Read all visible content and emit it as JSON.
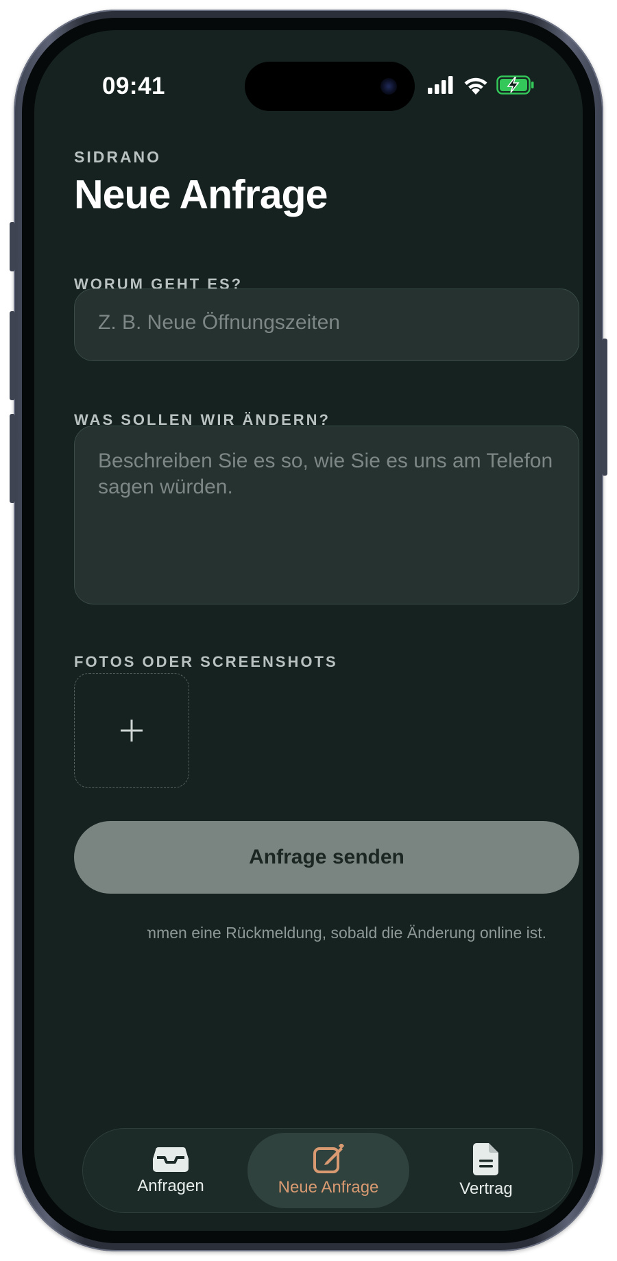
{
  "status_bar": {
    "time": "09:41",
    "icons": [
      "signal-icon",
      "wifi-icon",
      "battery-charging-icon"
    ]
  },
  "header": {
    "eyebrow": "SIDRANO",
    "title": "Neue Anfrage"
  },
  "form": {
    "topic_label": "WORUM GEHT ES?",
    "topic_placeholder": "Z. B. Neue Öffnungszeiten",
    "topic_value": "",
    "description_label": "WAS SOLLEN WIR ÄNDERN?",
    "description_placeholder": "Beschreiben Sie es so, wie Sie es uns am Telefon sagen würden.",
    "description_value": "",
    "photos_label": "FOTOS ODER SCREENSHOTS",
    "add_photo_icon": "plus-icon",
    "submit_label": "Anfrage senden",
    "hint": "mmen eine Rückmeldung, sobald die Änderung online ist."
  },
  "tabs": [
    {
      "label": "Anfragen",
      "icon": "inbox-icon",
      "active": false
    },
    {
      "label": "Neue Anfrage",
      "icon": "compose-icon",
      "active": true
    },
    {
      "label": "Vertrag",
      "icon": "document-icon",
      "active": false
    }
  ],
  "colors": {
    "background": "#152220",
    "accent": "#d99a72",
    "battery": "#34c759"
  }
}
